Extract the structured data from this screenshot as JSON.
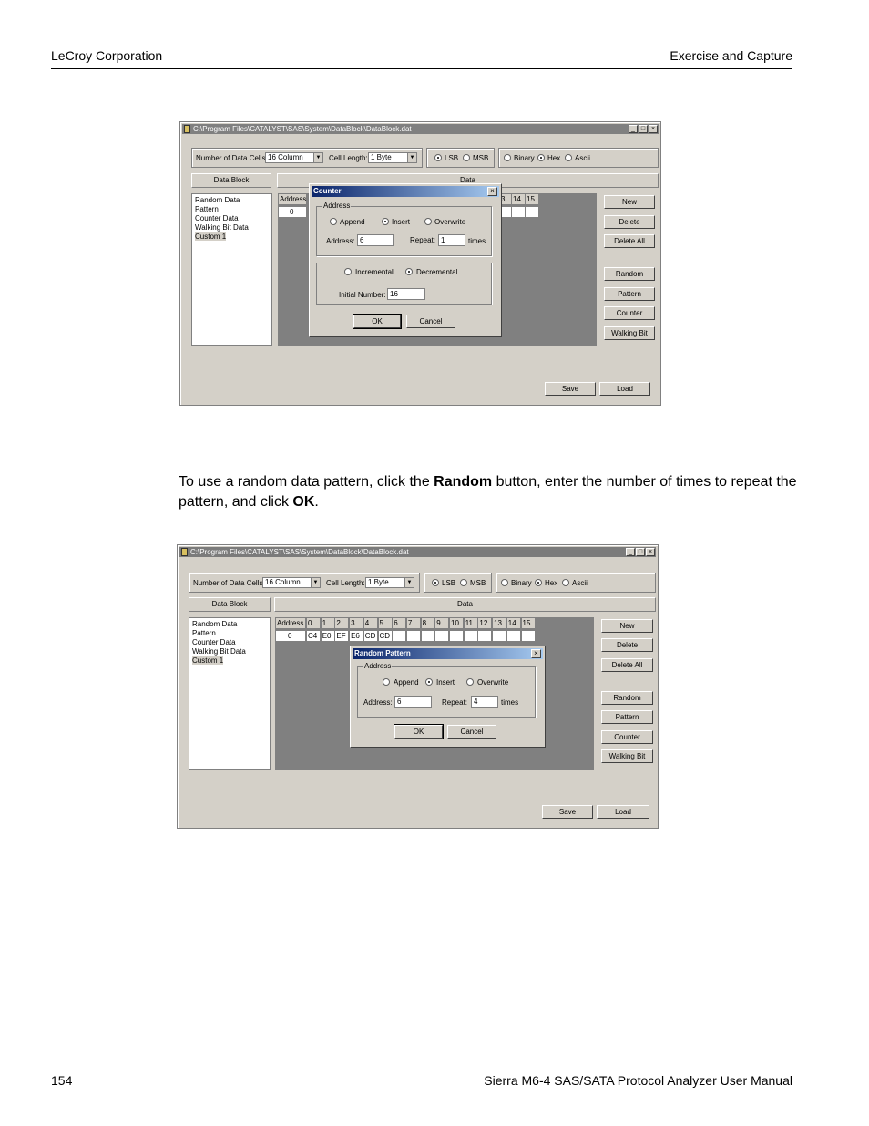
{
  "header": {
    "left": "LeCroy Corporation",
    "right": "Exercise and Capture"
  },
  "paragraph": {
    "before_random": "To use a random data pattern, click the ",
    "random": "Random",
    "middle": " button, enter the number of times to repeat the pattern, and click ",
    "ok": "OK",
    "end": "."
  },
  "footer": {
    "page_number": "154",
    "manual_title": "Sierra M6-4 SAS/SATA Protocol Analyzer User Manual"
  },
  "window1": {
    "title": "C:\\Program Files\\CATALYST\\SAS\\System\\DataBlock\\DataBlock.dat",
    "num_cells_label": "Number of Data Cells:",
    "num_cells_value": "16  Column",
    "cell_length_label": "Cell Length:",
    "cell_length_value": "1   Byte",
    "lsb": "LSB",
    "msb": "MSB",
    "binary": "Binary",
    "hex": "Hex",
    "ascii": "Ascii",
    "data_block_header": "Data Block",
    "data_header": "Data",
    "address_header": "Address",
    "address_value": "0",
    "cols_visible": [
      "3",
      "14",
      "15"
    ],
    "list": [
      "Random Data",
      "Pattern",
      "Counter Data",
      "Walking Bit Data",
      "Custom 1"
    ],
    "buttons": [
      "New",
      "Delete",
      "Delete All",
      "Random",
      "Pattern",
      "Counter",
      "Walking Bit"
    ],
    "save": "Save",
    "load": "Load",
    "dialog": {
      "title": "Counter",
      "address_group": "Address",
      "append": "Append",
      "insert": "Insert",
      "overwrite": "Overwrite",
      "address_label": "Address:",
      "address_value": "6",
      "repeat_label": "Repeat:",
      "repeat_value": "1",
      "times": "times",
      "incremental": "Incremental",
      "decremental": "Decremental",
      "initial_label": "Initial Number:",
      "initial_value": "16",
      "ok": "OK",
      "cancel": "Cancel"
    }
  },
  "window2": {
    "title": "C:\\Program Files\\CATALYST\\SAS\\System\\DataBlock\\DataBlock.dat",
    "num_cells_label": "Number of Data Cells:",
    "num_cells_value": "16  Column",
    "cell_length_label": "Cell Length:",
    "cell_length_value": "1   Byte",
    "lsb": "LSB",
    "msb": "MSB",
    "binary": "Binary",
    "hex": "Hex",
    "ascii": "Ascii",
    "data_block_header": "Data Block",
    "data_header": "Data",
    "address_header": "Address",
    "address_value": "0",
    "cols": [
      "0",
      "1",
      "2",
      "3",
      "4",
      "5",
      "6",
      "7",
      "8",
      "9",
      "10",
      "11",
      "12",
      "13",
      "14",
      "15"
    ],
    "values": [
      "C4",
      "E0",
      "EF",
      "E6",
      "CD",
      "CD"
    ],
    "list": [
      "Random Data",
      "Pattern",
      "Counter Data",
      "Walking Bit Data",
      "Custom 1"
    ],
    "buttons": [
      "New",
      "Delete",
      "Delete All",
      "Random",
      "Pattern",
      "Counter",
      "Walking Bit"
    ],
    "save": "Save",
    "load": "Load",
    "dialog": {
      "title": "Random Pattern",
      "address_group": "Address",
      "append": "Append",
      "insert": "Insert",
      "overwrite": "Overwrite",
      "address_label": "Address:",
      "address_value": "6",
      "repeat_label": "Repeat:",
      "repeat_value": "4",
      "times": "times",
      "ok": "OK",
      "cancel": "Cancel"
    }
  }
}
